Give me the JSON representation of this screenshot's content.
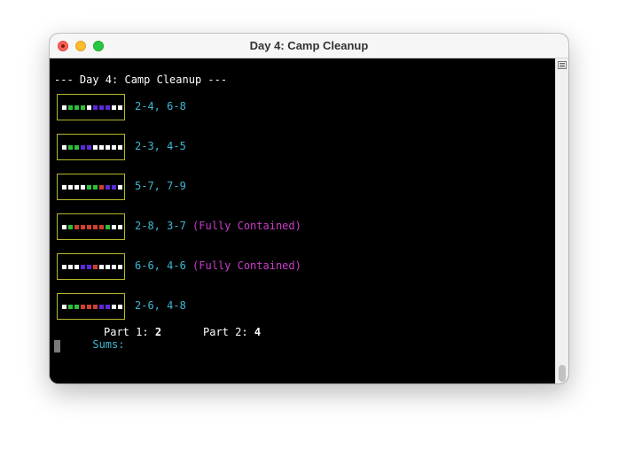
{
  "window": {
    "title": "Day 4: Camp Cleanup"
  },
  "terminal": {
    "heading": "--- Day 4: Camp Cleanup ---",
    "colors": {
      "white": "#ffffff",
      "green": "#2fbf3a",
      "purple": "#5a2bd8",
      "red": "#d0402c",
      "border": "#b8b82a",
      "label": "#3eb8d4",
      "contained": "#c93cc9"
    },
    "rows": [
      {
        "range_text": "2-4, 6-8",
        "status": "",
        "cells": [
          "white",
          "green",
          "green",
          "green",
          "white",
          "purple",
          "purple",
          "purple",
          "white",
          "white"
        ]
      },
      {
        "range_text": "2-3, 4-5",
        "status": "",
        "cells": [
          "white",
          "green",
          "green",
          "purple",
          "purple",
          "white",
          "white",
          "white",
          "white",
          "white"
        ]
      },
      {
        "range_text": "5-7, 7-9",
        "status": "",
        "cells": [
          "white",
          "white",
          "white",
          "white",
          "green",
          "green",
          "red",
          "purple",
          "purple",
          "white"
        ]
      },
      {
        "range_text": "2-8, 3-7",
        "status": "(Fully Contained)",
        "cells": [
          "white",
          "green",
          "red",
          "red",
          "red",
          "red",
          "red",
          "green",
          "white",
          "white"
        ]
      },
      {
        "range_text": "6-6, 4-6",
        "status": "(Fully Contained)",
        "cells": [
          "white",
          "white",
          "white",
          "purple",
          "purple",
          "red",
          "white",
          "white",
          "white",
          "white"
        ]
      },
      {
        "range_text": "2-6, 4-8",
        "status": "",
        "cells": [
          "white",
          "green",
          "green",
          "red",
          "red",
          "red",
          "purple",
          "purple",
          "white",
          "white"
        ]
      }
    ],
    "sums": {
      "label": "Sums:",
      "part1_label": "Part 1:",
      "part1_value": "2",
      "part2_label": "Part 2:",
      "part2_value": "4"
    }
  }
}
